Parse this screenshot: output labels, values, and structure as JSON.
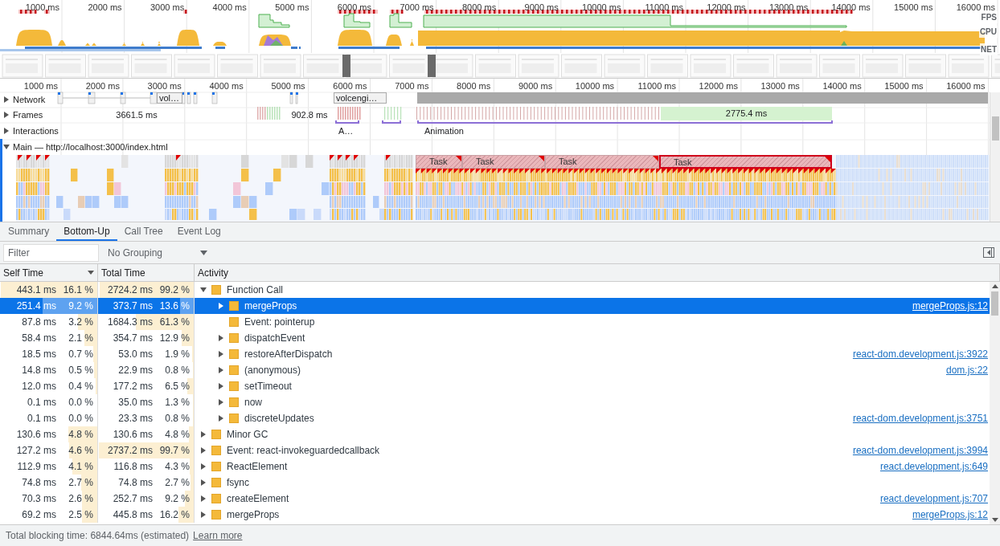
{
  "overview": {
    "ruler": [
      "1000 ms",
      "2000 ms",
      "3000 ms",
      "4000 ms",
      "5000 ms",
      "6000 ms",
      "7000 ms",
      "8000 ms",
      "9000 ms",
      "10000 ms",
      "11000 ms",
      "12000 ms",
      "13000 ms",
      "14000 ms",
      "15000 ms",
      "16000 ms"
    ],
    "lanes": [
      "FPS",
      "CPU",
      "NET"
    ]
  },
  "timeline": {
    "ruler": [
      "1000 ms",
      "2000 ms",
      "3000 ms",
      "4000 ms",
      "5000 ms",
      "6000 ms",
      "7000 ms",
      "8000 ms",
      "9000 ms",
      "10000 ms",
      "11000 ms",
      "12000 ms",
      "13000 ms",
      "14000 ms",
      "15000 ms",
      "16000 ms"
    ],
    "tracks": [
      {
        "kind": "network",
        "name": "Network",
        "expanded": false,
        "labels": [
          "vol…",
          "volcengi…"
        ]
      },
      {
        "kind": "frames",
        "name": "Frames",
        "expanded": false,
        "labels": [
          "3661.5 ms",
          "902.8 ms",
          "2775.4 ms"
        ]
      },
      {
        "kind": "interactions",
        "name": "Interactions",
        "expanded": false,
        "labels": [
          "A…",
          "Animation"
        ]
      },
      {
        "kind": "main",
        "name": "Main — http://localhost:3000/index.html",
        "expanded": true
      }
    ],
    "tasks": [
      {
        "label": "Task",
        "selected": false
      },
      {
        "label": "Task",
        "selected": false
      },
      {
        "label": "Task",
        "selected": false
      },
      {
        "label": "Task",
        "selected": true
      }
    ]
  },
  "tabs": [
    {
      "label": "Summary",
      "selected": false
    },
    {
      "label": "Bottom-Up",
      "selected": true
    },
    {
      "label": "Call Tree",
      "selected": false
    },
    {
      "label": "Event Log",
      "selected": false
    }
  ],
  "filter": {
    "placeholder": "Filter"
  },
  "grouping": "No Grouping",
  "table": {
    "columns": [
      "Self Time",
      "Total Time",
      "Activity"
    ],
    "rows": [
      {
        "self": {
          "time": "443.1 ms",
          "percent": "16.1 %",
          "level": 1
        },
        "total": {
          "time": "2724.2 ms",
          "percent": "99.2 %",
          "level": 0.99
        },
        "activity": "Function Call",
        "kind": "group",
        "expanded": true,
        "selected": false,
        "children": [
          {
            "self": {
              "time": "251.4 ms",
              "percent": "9.2 %",
              "level": 0.57
            },
            "total": {
              "time": "373.7 ms",
              "percent": "13.6 %",
              "level": 0.14
            },
            "activity": "mergeProps",
            "source": "mergeProps.js:12",
            "kind": "group",
            "expanded": false,
            "selected": true
          },
          {
            "self": {
              "time": "87.8 ms",
              "percent": "3.2 %",
              "level": 0.2
            },
            "total": {
              "time": "1684.3 ms",
              "percent": "61.3 %",
              "level": 0.61
            },
            "activity": "Event: pointerup",
            "kind": "leaf",
            "selected": false
          },
          {
            "self": {
              "time": "58.4 ms",
              "percent": "2.1 %",
              "level": 0.13
            },
            "total": {
              "time": "354.7 ms",
              "percent": "12.9 %",
              "level": 0.13
            },
            "activity": "dispatchEvent",
            "kind": "group",
            "expanded": false,
            "selected": false
          },
          {
            "self": {
              "time": "18.5 ms",
              "percent": "0.7 %",
              "level": 0.04
            },
            "total": {
              "time": "53.0 ms",
              "percent": "1.9 %",
              "level": 0.02
            },
            "activity": "restoreAfterDispatch",
            "source": "react-dom.development.js:3922",
            "kind": "group",
            "expanded": false,
            "selected": false
          },
          {
            "self": {
              "time": "14.8 ms",
              "percent": "0.5 %",
              "level": 0.03
            },
            "total": {
              "time": "22.9 ms",
              "percent": "0.8 %",
              "level": 0.01
            },
            "activity": "(anonymous)",
            "source": "dom.js:22",
            "kind": "group",
            "expanded": false,
            "selected": false
          },
          {
            "self": {
              "time": "12.0 ms",
              "percent": "0.4 %",
              "level": 0.02
            },
            "total": {
              "time": "177.2 ms",
              "percent": "6.5 %",
              "level": 0.07
            },
            "activity": "setTimeout",
            "kind": "group",
            "expanded": false,
            "selected": false
          },
          {
            "self": {
              "time": "0.1 ms",
              "percent": "0.0 %",
              "level": 0
            },
            "total": {
              "time": "35.0 ms",
              "percent": "1.3 %",
              "level": 0.01
            },
            "activity": "now",
            "kind": "group",
            "expanded": false,
            "selected": false
          },
          {
            "self": {
              "time": "0.1 ms",
              "percent": "0.0 %",
              "level": 0
            },
            "total": {
              "time": "23.3 ms",
              "percent": "0.8 %",
              "level": 0.01
            },
            "activity": "discreteUpdates",
            "source": "react-dom.development.js:3751",
            "kind": "group",
            "expanded": false,
            "selected": false
          }
        ]
      },
      {
        "self": {
          "time": "130.6 ms",
          "percent": "4.8 %",
          "level": 0.3
        },
        "total": {
          "time": "130.6 ms",
          "percent": "4.8 %",
          "level": 0.05
        },
        "activity": "Minor GC",
        "kind": "group",
        "expanded": false,
        "selected": false
      },
      {
        "self": {
          "time": "127.2 ms",
          "percent": "4.6 %",
          "level": 0.29
        },
        "total": {
          "time": "2737.2 ms",
          "percent": "99.7 %",
          "level": 1
        },
        "activity": "Event: react-invokeguardedcallback",
        "source": "react-dom.development.js:3994",
        "kind": "group",
        "expanded": false,
        "selected": false
      },
      {
        "self": {
          "time": "112.9 ms",
          "percent": "4.1 %",
          "level": 0.26
        },
        "total": {
          "time": "116.8 ms",
          "percent": "4.3 %",
          "level": 0.04
        },
        "activity": "ReactElement",
        "source": "react.development.js:649",
        "kind": "group",
        "expanded": false,
        "selected": false
      },
      {
        "self": {
          "time": "74.8 ms",
          "percent": "2.7 %",
          "level": 0.17
        },
        "total": {
          "time": "74.8 ms",
          "percent": "2.7 %",
          "level": 0.03
        },
        "activity": "fsync",
        "kind": "group",
        "expanded": false,
        "selected": false
      },
      {
        "self": {
          "time": "70.3 ms",
          "percent": "2.6 %",
          "level": 0.16
        },
        "total": {
          "time": "252.7 ms",
          "percent": "9.2 %",
          "level": 0.09
        },
        "activity": "createElement",
        "source": "react.development.js:707",
        "kind": "group",
        "expanded": false,
        "selected": false
      },
      {
        "self": {
          "time": "69.2 ms",
          "percent": "2.5 %",
          "level": 0.16
        },
        "total": {
          "time": "445.8 ms",
          "percent": "16.2 %",
          "level": 0.16
        },
        "activity": "mergeProps",
        "source": "mergeProps.js:12",
        "kind": "group",
        "expanded": false,
        "selected": false
      }
    ]
  },
  "footer": {
    "text": "Total blocking time: 6844.64ms (estimated)",
    "link": "Learn more"
  }
}
